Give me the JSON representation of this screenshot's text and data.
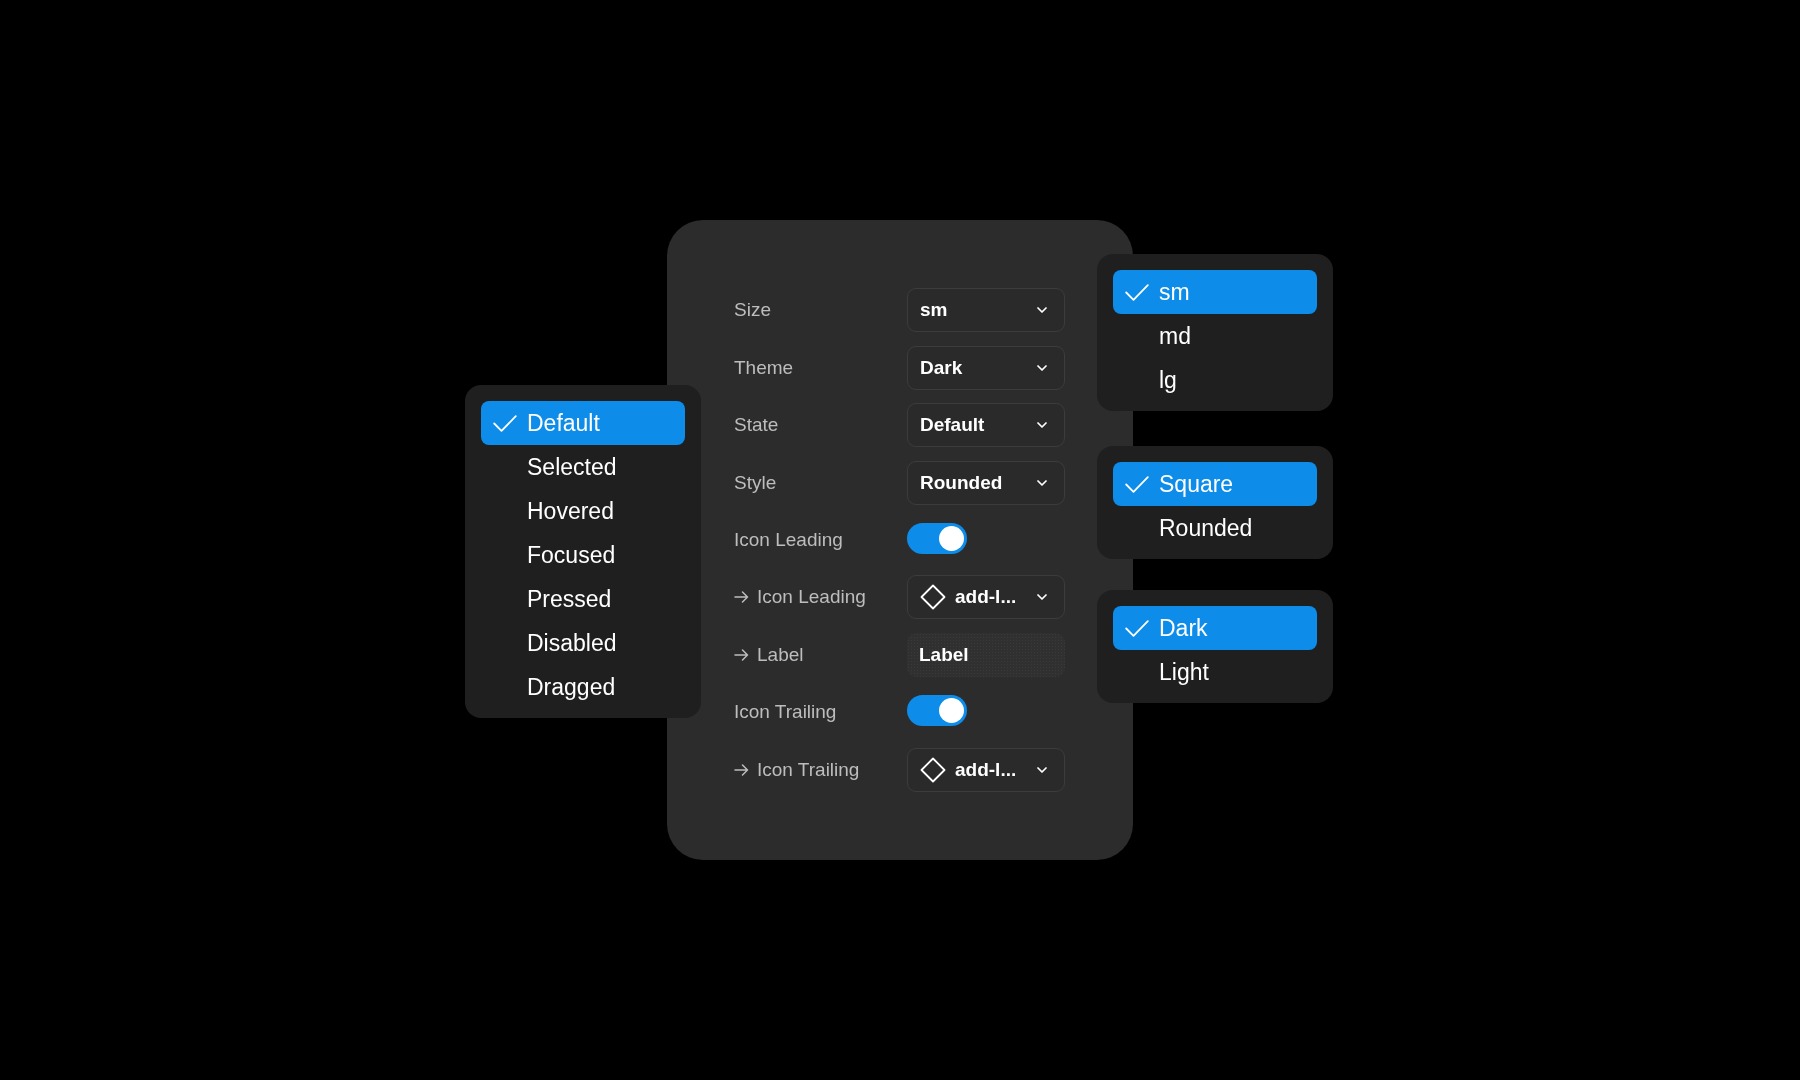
{
  "state_menu": {
    "items": [
      {
        "label": "Default",
        "selected": true
      },
      {
        "label": "Selected",
        "selected": false
      },
      {
        "label": "Hovered",
        "selected": false
      },
      {
        "label": "Focused",
        "selected": false
      },
      {
        "label": "Pressed",
        "selected": false
      },
      {
        "label": "Disabled",
        "selected": false
      },
      {
        "label": "Dragged",
        "selected": false
      }
    ]
  },
  "properties_panel": {
    "rows": [
      {
        "label": "Size",
        "nested": false,
        "kind": "select",
        "value": "sm"
      },
      {
        "label": "Theme",
        "nested": false,
        "kind": "select",
        "value": "Dark"
      },
      {
        "label": "State",
        "nested": false,
        "kind": "select",
        "value": "Default"
      },
      {
        "label": "Style",
        "nested": false,
        "kind": "select",
        "value": "Rounded"
      },
      {
        "label": "Icon Leading",
        "nested": false,
        "kind": "toggle",
        "on": true
      },
      {
        "label": "Icon Leading",
        "nested": true,
        "kind": "icon_select",
        "value": "add-l..."
      },
      {
        "label": "Label",
        "nested": true,
        "kind": "text_field",
        "value": "Label"
      },
      {
        "label": "Icon Trailing",
        "nested": false,
        "kind": "toggle",
        "on": true
      },
      {
        "label": "Icon Trailing",
        "nested": true,
        "kind": "icon_select",
        "value": "add-l..."
      }
    ]
  },
  "size_menu": {
    "items": [
      {
        "label": "sm",
        "selected": true
      },
      {
        "label": "md",
        "selected": false
      },
      {
        "label": "lg",
        "selected": false
      }
    ]
  },
  "style_menu": {
    "items": [
      {
        "label": "Square",
        "selected": true
      },
      {
        "label": "Rounded",
        "selected": false
      }
    ]
  },
  "theme_menu": {
    "items": [
      {
        "label": "Dark",
        "selected": true
      },
      {
        "label": "Light",
        "selected": false
      }
    ]
  }
}
